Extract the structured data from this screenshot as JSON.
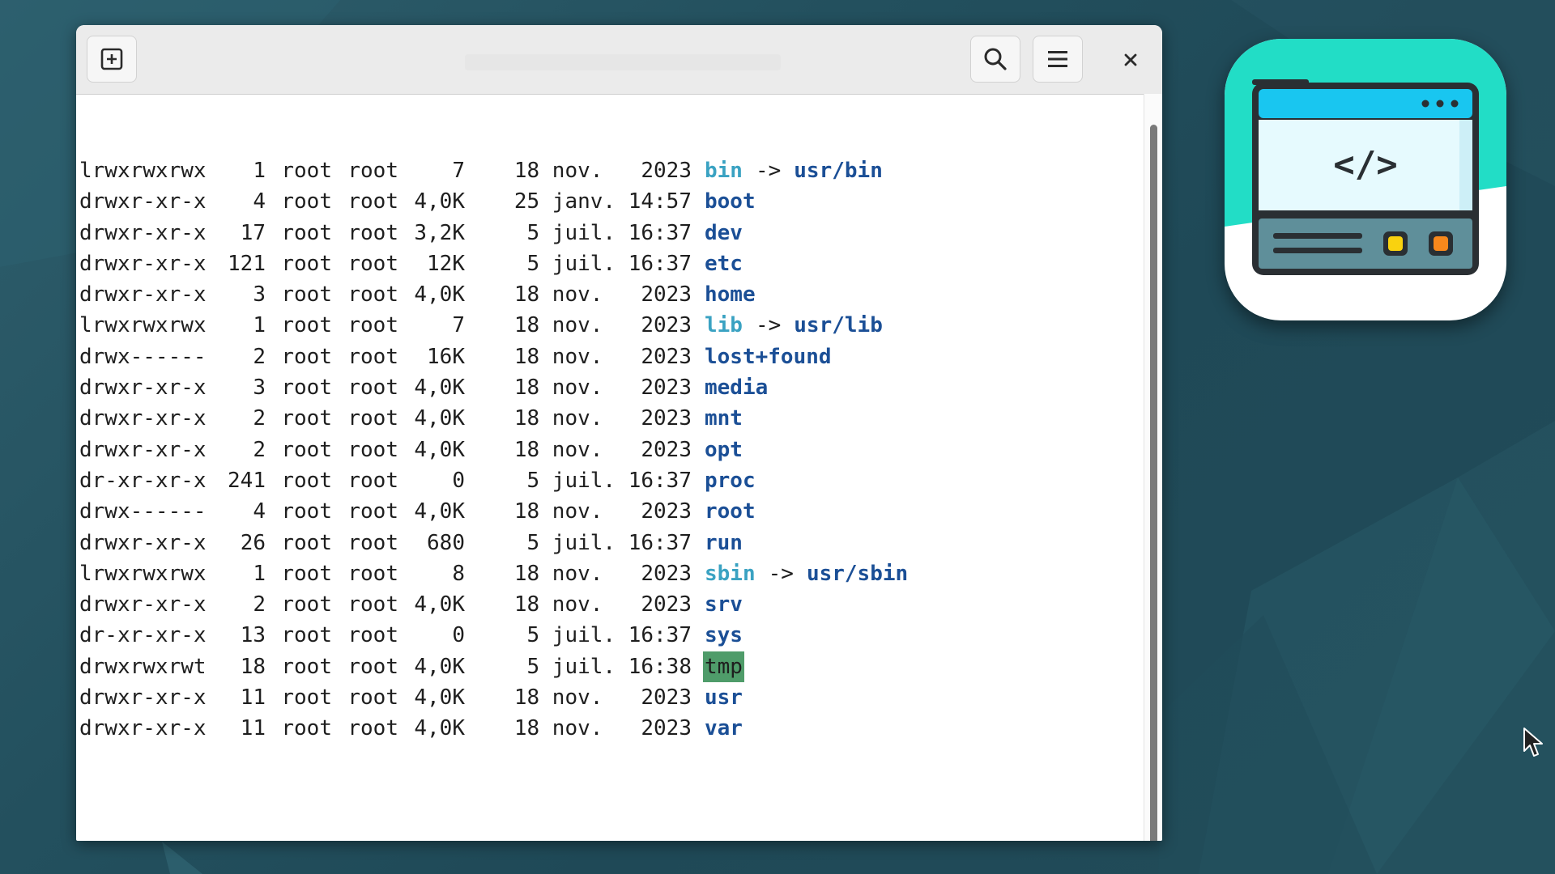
{
  "desktop": {
    "background_colors": [
      "#2e5e6c",
      "#1f4957"
    ]
  },
  "terminal": {
    "header_buttons": {
      "new_tab_icon": "new-tab-icon",
      "search_icon": "search-icon",
      "menu_icon": "hamburger-menu-icon",
      "close_icon": "close-icon"
    },
    "listing": [
      {
        "perms": "lrwxrwxrwx",
        "links": "1",
        "owner": "root",
        "group": "root",
        "size": "7",
        "date": "18 nov.   2023",
        "name": "bin",
        "type": "symlink",
        "target": "usr/bin"
      },
      {
        "perms": "drwxr-xr-x",
        "links": "4",
        "owner": "root",
        "group": "root",
        "size": "4,0K",
        "date": "25 janv. 14:57",
        "name": "boot",
        "type": "dir"
      },
      {
        "perms": "drwxr-xr-x",
        "links": "17",
        "owner": "root",
        "group": "root",
        "size": "3,2K",
        "date": " 5 juil. 16:37",
        "name": "dev",
        "type": "dir"
      },
      {
        "perms": "drwxr-xr-x",
        "links": "121",
        "owner": "root",
        "group": "root",
        "size": "12K",
        "date": " 5 juil. 16:37",
        "name": "etc",
        "type": "dir"
      },
      {
        "perms": "drwxr-xr-x",
        "links": "3",
        "owner": "root",
        "group": "root",
        "size": "4,0K",
        "date": "18 nov.   2023",
        "name": "home",
        "type": "dir"
      },
      {
        "perms": "lrwxrwxrwx",
        "links": "1",
        "owner": "root",
        "group": "root",
        "size": "7",
        "date": "18 nov.   2023",
        "name": "lib",
        "type": "symlink",
        "target": "usr/lib"
      },
      {
        "perms": "drwx------",
        "links": "2",
        "owner": "root",
        "group": "root",
        "size": "16K",
        "date": "18 nov.   2023",
        "name": "lost+found",
        "type": "dir"
      },
      {
        "perms": "drwxr-xr-x",
        "links": "3",
        "owner": "root",
        "group": "root",
        "size": "4,0K",
        "date": "18 nov.   2023",
        "name": "media",
        "type": "dir"
      },
      {
        "perms": "drwxr-xr-x",
        "links": "2",
        "owner": "root",
        "group": "root",
        "size": "4,0K",
        "date": "18 nov.   2023",
        "name": "mnt",
        "type": "dir"
      },
      {
        "perms": "drwxr-xr-x",
        "links": "2",
        "owner": "root",
        "group": "root",
        "size": "4,0K",
        "date": "18 nov.   2023",
        "name": "opt",
        "type": "dir"
      },
      {
        "perms": "dr-xr-xr-x",
        "links": "241",
        "owner": "root",
        "group": "root",
        "size": "0",
        "date": " 5 juil. 16:37",
        "name": "proc",
        "type": "dir"
      },
      {
        "perms": "drwx------",
        "links": "4",
        "owner": "root",
        "group": "root",
        "size": "4,0K",
        "date": "18 nov.   2023",
        "name": "root",
        "type": "dir"
      },
      {
        "perms": "drwxr-xr-x",
        "links": "26",
        "owner": "root",
        "group": "root",
        "size": "680",
        "date": " 5 juil. 16:37",
        "name": "run",
        "type": "dir"
      },
      {
        "perms": "lrwxrwxrwx",
        "links": "1",
        "owner": "root",
        "group": "root",
        "size": "8",
        "date": "18 nov.   2023",
        "name": "sbin",
        "type": "symlink",
        "target": "usr/sbin"
      },
      {
        "perms": "drwxr-xr-x",
        "links": "2",
        "owner": "root",
        "group": "root",
        "size": "4,0K",
        "date": "18 nov.   2023",
        "name": "srv",
        "type": "dir"
      },
      {
        "perms": "dr-xr-xr-x",
        "links": "13",
        "owner": "root",
        "group": "root",
        "size": "0",
        "date": " 5 juil. 16:37",
        "name": "sys",
        "type": "dir"
      },
      {
        "perms": "drwxrwxrwt",
        "links": "18",
        "owner": "root",
        "group": "root",
        "size": "4,0K",
        "date": " 5 juil. 16:38",
        "name": "tmp",
        "type": "sticky"
      },
      {
        "perms": "drwxr-xr-x",
        "links": "11",
        "owner": "root",
        "group": "root",
        "size": "4,0K",
        "date": "18 nov.   2023",
        "name": "usr",
        "type": "dir"
      },
      {
        "perms": "drwxr-xr-x",
        "links": "11",
        "owner": "root",
        "group": "root",
        "size": "4,0K",
        "date": "18 nov.   2023",
        "name": "var",
        "type": "dir"
      }
    ],
    "colors": {
      "directory": "#1b4f96",
      "symlink": "#3aa2c2",
      "sticky_background": "#4f9c6a",
      "text": "#1e1e1e"
    }
  },
  "app_icon": {
    "icon": "code-window-app-icon",
    "code_glyph": "</>"
  }
}
